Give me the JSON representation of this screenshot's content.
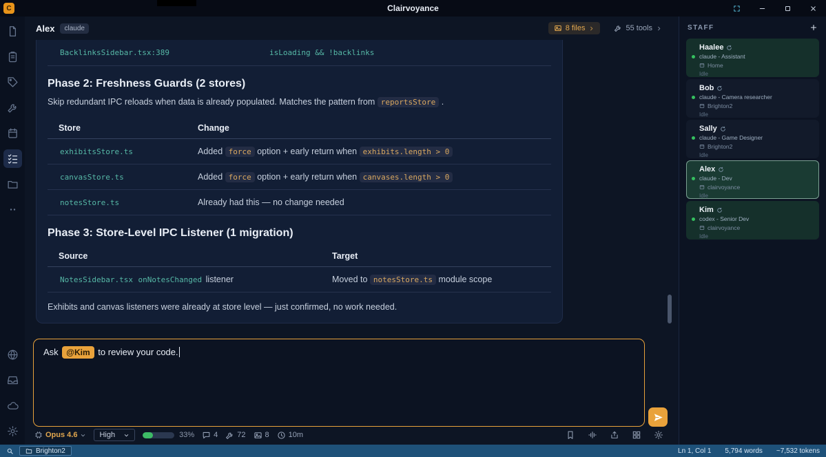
{
  "window": {
    "title": "Clairvoyance",
    "logo_letter": "C"
  },
  "chat": {
    "agent_name": "Alex",
    "agent_badge": "claude",
    "files_button": {
      "label": "8 files"
    },
    "tools_button": {
      "label": "55 tools"
    },
    "message": {
      "partial_row": {
        "left": [
          {
            "v": "BacklinksSidebar.tsx:389",
            "c": "teal"
          }
        ],
        "right": [
          {
            "v": "isLoading && !backlinks",
            "c": "teal"
          }
        ]
      },
      "phase2_heading": "Phase 2: Freshness Guards (2 stores)",
      "phase2_intro": [
        {
          "v": "Skip redundant IPC reloads when data is already populated. Matches the pattern from "
        },
        {
          "v": "reportsStore",
          "c": "gold"
        },
        {
          "v": " ."
        }
      ],
      "store_table": {
        "headers": [
          "Store",
          "Change"
        ],
        "rows": [
          [
            [
              {
                "v": "exhibitsStore.ts",
                "c": "teal"
              }
            ],
            [
              {
                "v": "Added "
              },
              {
                "v": "force",
                "c": "gold"
              },
              {
                "v": " option + early return when "
              },
              {
                "v": "exhibits.length > 0",
                "c": "gold"
              }
            ]
          ],
          [
            [
              {
                "v": "canvasStore.ts",
                "c": "teal"
              }
            ],
            [
              {
                "v": "Added "
              },
              {
                "v": "force",
                "c": "gold"
              },
              {
                "v": " option + early return when "
              },
              {
                "v": "canvases.length > 0",
                "c": "gold"
              }
            ]
          ],
          [
            [
              {
                "v": "notesStore.ts",
                "c": "teal"
              }
            ],
            [
              {
                "v": "Already had this — no change needed"
              }
            ]
          ]
        ]
      },
      "phase3_heading": "Phase 3: Store-Level IPC Listener (1 migration)",
      "migration_table": {
        "headers": [
          "Source",
          "Target"
        ],
        "rows": [
          [
            [
              {
                "v": "NotesSidebar.tsx",
                "c": "teal"
              },
              {
                "v": "  "
              },
              {
                "v": "onNotesChanged",
                "c": "teal"
              },
              {
                "v": " listener"
              }
            ],
            [
              {
                "v": "Moved to "
              },
              {
                "v": "notesStore.ts",
                "c": "gold"
              },
              {
                "v": " module scope"
              }
            ]
          ]
        ]
      },
      "outro": "Exhibits and canvas listeners were already at store level — just confirmed, no work needed."
    }
  },
  "composer": {
    "text_before": "Ask ",
    "mention": "@Kim",
    "text_after": " to review your code."
  },
  "toolbar": {
    "model": "Opus 4.6",
    "effort": "High",
    "context_pct": "33%",
    "chats": "4",
    "tools": "72",
    "attachments": "8",
    "elapsed": "10m"
  },
  "staff": {
    "title": "STAFF",
    "members": [
      {
        "name": "Haalee",
        "role": "claude - Assistant",
        "project": "Home",
        "status": "Idle",
        "variant": "green"
      },
      {
        "name": "Bob",
        "role": "claude - Camera researcher",
        "project": "Brighton2",
        "status": "Idle",
        "variant": "dark"
      },
      {
        "name": "Sally",
        "role": "claude - Game Designer",
        "project": "Brighton2",
        "status": "Idle",
        "variant": "dark"
      },
      {
        "name": "Alex",
        "role": "claude - Dev",
        "project": "clairvoyance",
        "status": "Idle",
        "variant": "selected"
      },
      {
        "name": "Kim",
        "role": "codex - Senior Dev",
        "project": "clairvoyance",
        "status": "Idle",
        "variant": "green"
      }
    ]
  },
  "statusbar": {
    "project": "Brighton2",
    "cursor": "Ln 1, Col 1",
    "words": "5,794 words",
    "tokens": "~7,532 tokens"
  }
}
